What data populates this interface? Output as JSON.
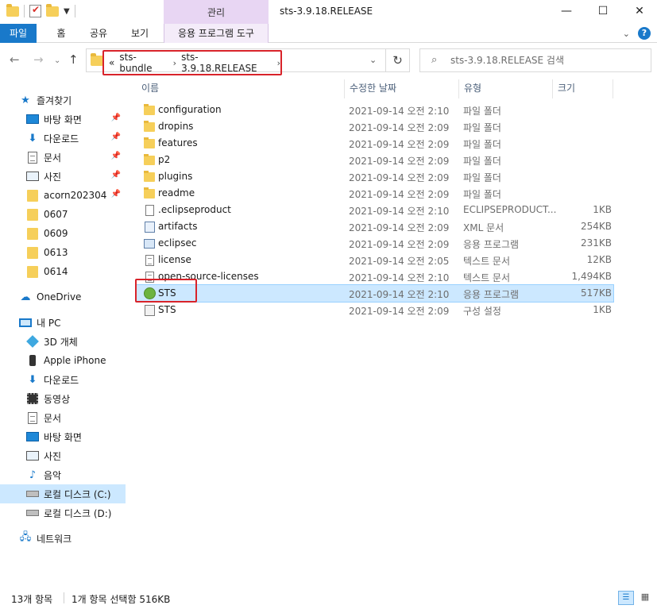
{
  "window": {
    "title": "sts-3.9.18.RELEASE",
    "manage_tab": "관리",
    "minimize": "—",
    "maximize": "☐",
    "close": "✕"
  },
  "ribbon": {
    "tabs": [
      "파일",
      "홈",
      "공유",
      "보기",
      "응용 프로그램 도구"
    ],
    "expand": "⌄",
    "help": "?"
  },
  "nav": {
    "back": "←",
    "forward": "→",
    "recent": "⌄",
    "up": "↑",
    "crumb_prefix": "«",
    "crumbs": [
      "sts-bundle",
      "sts-3.9.18.RELEASE"
    ],
    "crumb_sep": "›",
    "addr_dropdown": "⌄",
    "refresh": "↻",
    "search_placeholder": "sts-3.9.18.RELEASE 검색"
  },
  "sidebar": {
    "quick_access": "즐겨찾기",
    "pinned": [
      {
        "label": "바탕 화면",
        "icon": "desktop-icon"
      },
      {
        "label": "다운로드",
        "icon": "download-icon"
      },
      {
        "label": "문서",
        "icon": "document-icon"
      },
      {
        "label": "사진",
        "icon": "pictures-icon"
      },
      {
        "label": "acorn202304",
        "icon": "folder-icon"
      }
    ],
    "recent_folders": [
      "0607",
      "0609",
      "0613",
      "0614"
    ],
    "onedrive": "OneDrive",
    "this_pc": "내 PC",
    "pc_items": [
      {
        "label": "3D 개체",
        "icon": "3d-objects-icon"
      },
      {
        "label": "Apple iPhone",
        "icon": "phone-icon"
      },
      {
        "label": "다운로드",
        "icon": "download-icon"
      },
      {
        "label": "동영상",
        "icon": "video-icon"
      },
      {
        "label": "문서",
        "icon": "document-icon"
      },
      {
        "label": "바탕 화면",
        "icon": "desktop-icon"
      },
      {
        "label": "사진",
        "icon": "pictures-icon"
      },
      {
        "label": "음악",
        "icon": "music-icon"
      },
      {
        "label": "로컬 디스크 (C:)",
        "icon": "drive-icon"
      },
      {
        "label": "로컬 디스크 (D:)",
        "icon": "drive-icon"
      }
    ],
    "network": "네트워크"
  },
  "columns": {
    "name": "이름",
    "date": "수정한 날짜",
    "type": "유형",
    "size": "크기"
  },
  "files": [
    {
      "name": "configuration",
      "date": "2021-09-14 오전 2:10",
      "type": "파일 폴더",
      "size": "",
      "icon": "folder-icon"
    },
    {
      "name": "dropins",
      "date": "2021-09-14 오전 2:09",
      "type": "파일 폴더",
      "size": "",
      "icon": "folder-icon"
    },
    {
      "name": "features",
      "date": "2021-09-14 오전 2:09",
      "type": "파일 폴더",
      "size": "",
      "icon": "folder-icon"
    },
    {
      "name": "p2",
      "date": "2021-09-14 오전 2:09",
      "type": "파일 폴더",
      "size": "",
      "icon": "folder-icon"
    },
    {
      "name": "plugins",
      "date": "2021-09-14 오전 2:09",
      "type": "파일 폴더",
      "size": "",
      "icon": "folder-icon"
    },
    {
      "name": "readme",
      "date": "2021-09-14 오전 2:09",
      "type": "파일 폴더",
      "size": "",
      "icon": "folder-icon"
    },
    {
      "name": ".eclipseproduct",
      "date": "2021-09-14 오전 2:10",
      "type": "ECLIPSEPRODUCT...",
      "size": "1KB",
      "icon": "file-icon"
    },
    {
      "name": "artifacts",
      "date": "2021-09-14 오전 2:09",
      "type": "XML 문서",
      "size": "254KB",
      "icon": "xml-icon"
    },
    {
      "name": "eclipsec",
      "date": "2021-09-14 오전 2:09",
      "type": "응용 프로그램",
      "size": "231KB",
      "icon": "application-icon"
    },
    {
      "name": "license",
      "date": "2021-09-14 오전 2:05",
      "type": "텍스트 문서",
      "size": "12KB",
      "icon": "text-file-icon"
    },
    {
      "name": "open-source-licenses",
      "date": "2021-09-14 오전 2:10",
      "type": "텍스트 문서",
      "size": "1,494KB",
      "icon": "text-file-icon"
    },
    {
      "name": "STS",
      "date": "2021-09-14 오전 2:10",
      "type": "응용 프로그램",
      "size": "517KB",
      "icon": "sts-app-icon",
      "selected": true
    },
    {
      "name": "STS",
      "date": "2021-09-14 오전 2:09",
      "type": "구성 설정",
      "size": "1KB",
      "icon": "config-file-icon"
    }
  ],
  "status": {
    "item_count": "13개 항목",
    "selection": "1개 항목 선택함 516KB"
  },
  "colors": {
    "accent": "#1979ca",
    "selection": "#cce8ff",
    "annotation": "#d8232a",
    "manage_tab": "#e8d6f3"
  }
}
